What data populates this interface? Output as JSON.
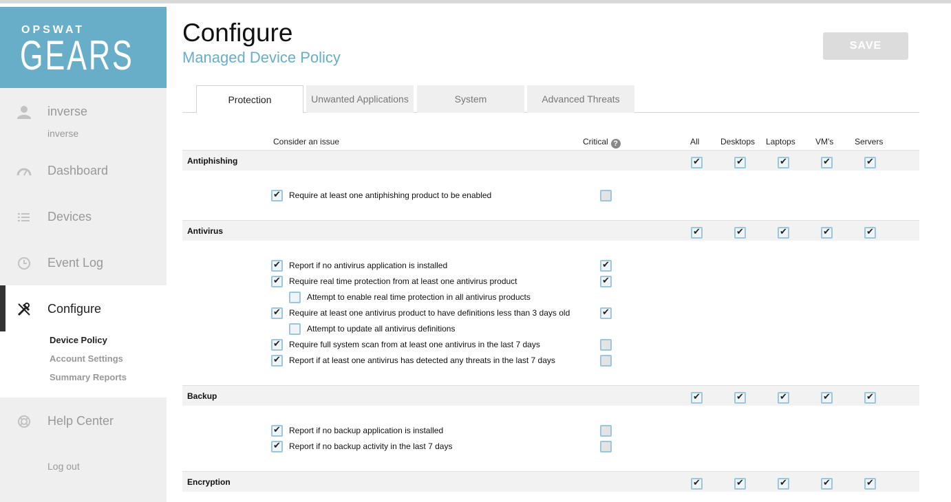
{
  "brand": {
    "top": "OPSWAT",
    "product": "GEARS"
  },
  "user": {
    "name": "inverse",
    "sub": "inverse"
  },
  "nav": {
    "dashboard": "Dashboard",
    "devices": "Devices",
    "event_log": "Event Log",
    "configure": "Configure",
    "configure_sub": [
      "Device Policy",
      "Account Settings",
      "Summary Reports"
    ],
    "help_center": "Help Center",
    "logout": "Log out"
  },
  "page": {
    "title": "Configure",
    "subtitle": "Managed Device Policy",
    "save_label": "SAVE"
  },
  "tabs": [
    "Protection",
    "Unwanted Applications",
    "System",
    "Advanced Threats"
  ],
  "columns": {
    "issue": "Consider an issue",
    "critical": "Critical",
    "help": "?",
    "groups": [
      "All",
      "Desktops",
      "Laptops",
      "VM's",
      "Servers"
    ]
  },
  "sections": [
    {
      "name": "Antiphishing",
      "group_checks": [
        true,
        true,
        true,
        true,
        true
      ],
      "rules": [
        {
          "label": "Require at least one antiphishing product to be enabled",
          "checked": true,
          "critical": false,
          "indent": 0
        }
      ]
    },
    {
      "name": "Antivirus",
      "group_checks": [
        true,
        true,
        true,
        true,
        true
      ],
      "rules": [
        {
          "label": "Report if no antivirus application is installed",
          "checked": true,
          "critical": true,
          "indent": 0
        },
        {
          "label": "Require real time protection from at least one antivirus product",
          "checked": true,
          "critical": true,
          "indent": 0
        },
        {
          "label": "Attempt to enable real time protection in all antivirus products",
          "checked": false,
          "critical": null,
          "indent": 1
        },
        {
          "label": "Require at least one antivirus product to have definitions less than 3 days old",
          "checked": true,
          "critical": true,
          "indent": 0
        },
        {
          "label": "Attempt to update all antivirus definitions",
          "checked": false,
          "critical": null,
          "indent": 1
        },
        {
          "label": "Require full system scan from at least one antivirus in the last 7 days",
          "checked": true,
          "critical": false,
          "indent": 0
        },
        {
          "label": "Report if at least one antivirus has detected any threats in the last 7 days",
          "checked": true,
          "critical": false,
          "indent": 0
        }
      ]
    },
    {
      "name": "Backup",
      "group_checks": [
        true,
        true,
        true,
        true,
        true
      ],
      "rules": [
        {
          "label": "Report if no backup application is installed",
          "checked": true,
          "critical": false,
          "indent": 0
        },
        {
          "label": "Report if no backup activity in the last 7 days",
          "checked": true,
          "critical": false,
          "indent": 0
        }
      ]
    },
    {
      "name": "Encryption",
      "group_checks": [
        true,
        true,
        true,
        true,
        true
      ],
      "rules": []
    }
  ]
}
